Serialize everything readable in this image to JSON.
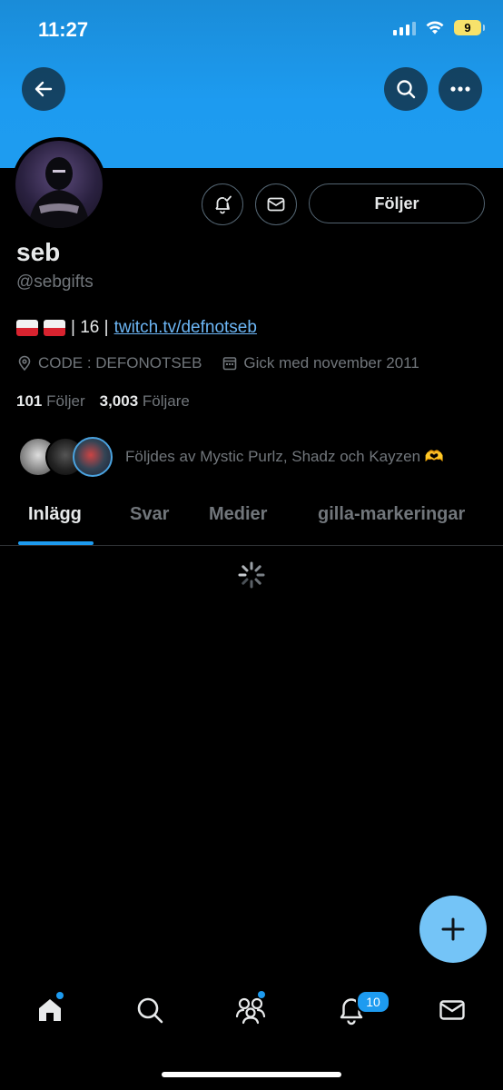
{
  "status_bar": {
    "time": "11:27",
    "battery": "9"
  },
  "profile": {
    "name": "seb",
    "handle": "@sebgifts",
    "bio_text": "| 16 |",
    "bio_link": "twitch.tv/defnotseb",
    "location": "CODE : DEFONOTSEB",
    "joined": "Gick med november 2011",
    "following_count": "101",
    "following_label": "Följer",
    "followers_count": "3,003",
    "followers_label": "Följare",
    "followed_by": "Följdes av Mystic Purlz, Shadz och Kayzen 🫶"
  },
  "actions": {
    "follow_label": "Följer"
  },
  "tabs": [
    {
      "label": "Inlägg"
    },
    {
      "label": "Svar"
    },
    {
      "label": "Medier"
    },
    {
      "label": "gilla-markeringar"
    }
  ],
  "bottom_nav": {
    "notifications_badge": "10",
    "items": [
      "home-icon",
      "search-icon",
      "communities-icon",
      "notifications-icon",
      "messages-icon"
    ]
  },
  "colors": {
    "accent": "#1d9bf0",
    "banner": "#1d9bf0",
    "fab": "#74c4f7"
  }
}
